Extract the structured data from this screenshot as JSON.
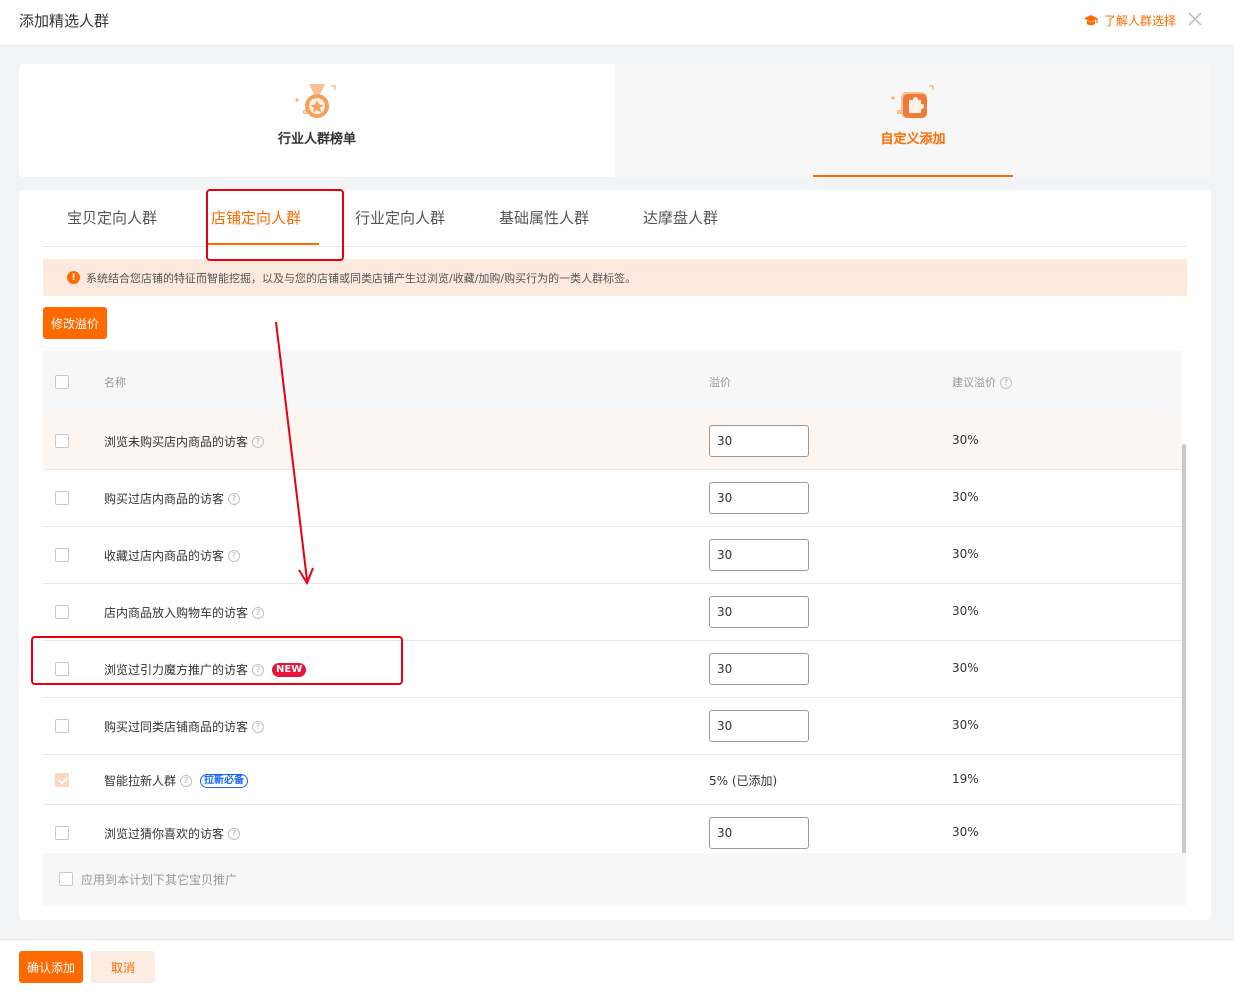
{
  "header": {
    "title": "添加精选人群",
    "learn_link": "了解人群选择",
    "icons": {
      "learn": "graduation-cap-icon",
      "close": "close-icon"
    }
  },
  "modes": [
    {
      "label": "行业人群榜单",
      "icon": "medal-icon",
      "active": false
    },
    {
      "label": "自定义添加",
      "icon": "puzzle-icon",
      "active": true
    }
  ],
  "tabs": [
    {
      "label": "宝贝定向人群",
      "active": false
    },
    {
      "label": "店铺定向人群",
      "active": true
    },
    {
      "label": "行业定向人群",
      "active": false
    },
    {
      "label": "基础属性人群",
      "active": false
    },
    {
      "label": "达摩盘人群",
      "active": false
    }
  ],
  "notice": {
    "icon_text": "!",
    "text": "系统结合您店铺的特征而智能挖掘，以及与您的店铺或同类店铺产生过浏览/收藏/加购/购买行为的一类人群标签。"
  },
  "toolbar": {
    "modify_label": "修改溢价"
  },
  "table": {
    "columns": {
      "name": "名称",
      "premium": "溢价",
      "suggest": "建议溢价"
    },
    "help_glyph": "?",
    "rows": [
      {
        "name": "浏览未购买店内商品的访客",
        "premium": "30",
        "suggest": "30%",
        "checked": false
      },
      {
        "name": "购买过店内商品的访客",
        "premium": "30",
        "suggest": "30%",
        "checked": false
      },
      {
        "name": "收藏过店内商品的访客",
        "premium": "30",
        "suggest": "30%",
        "checked": false
      },
      {
        "name": "店内商品放入购物车的访客",
        "premium": "30",
        "suggest": "30%",
        "checked": false
      },
      {
        "name": "浏览过引力魔方推广的访客",
        "premium": "30",
        "suggest": "30%",
        "checked": false,
        "badge": "NEW"
      },
      {
        "name": "购买过同类店铺商品的访客",
        "premium": "30",
        "suggest": "30%",
        "checked": false
      },
      {
        "name": "智能拉新人群",
        "premium_text": "5% (已添加)",
        "suggest": "19%",
        "checked": true,
        "badge": "拉新必备"
      },
      {
        "name": "浏览过猜你喜欢的访客",
        "premium": "30",
        "suggest": "30%",
        "checked": false
      }
    ]
  },
  "apply": {
    "label": "应用到本计划下其它宝贝推广"
  },
  "footer": {
    "confirm_label": "确认添加",
    "cancel_label": "取消"
  },
  "colors": {
    "accent": "#ff6a00",
    "annotation": "#e60012",
    "badge_new": "#e8143c",
    "badge_blue": "#1a66ff"
  }
}
